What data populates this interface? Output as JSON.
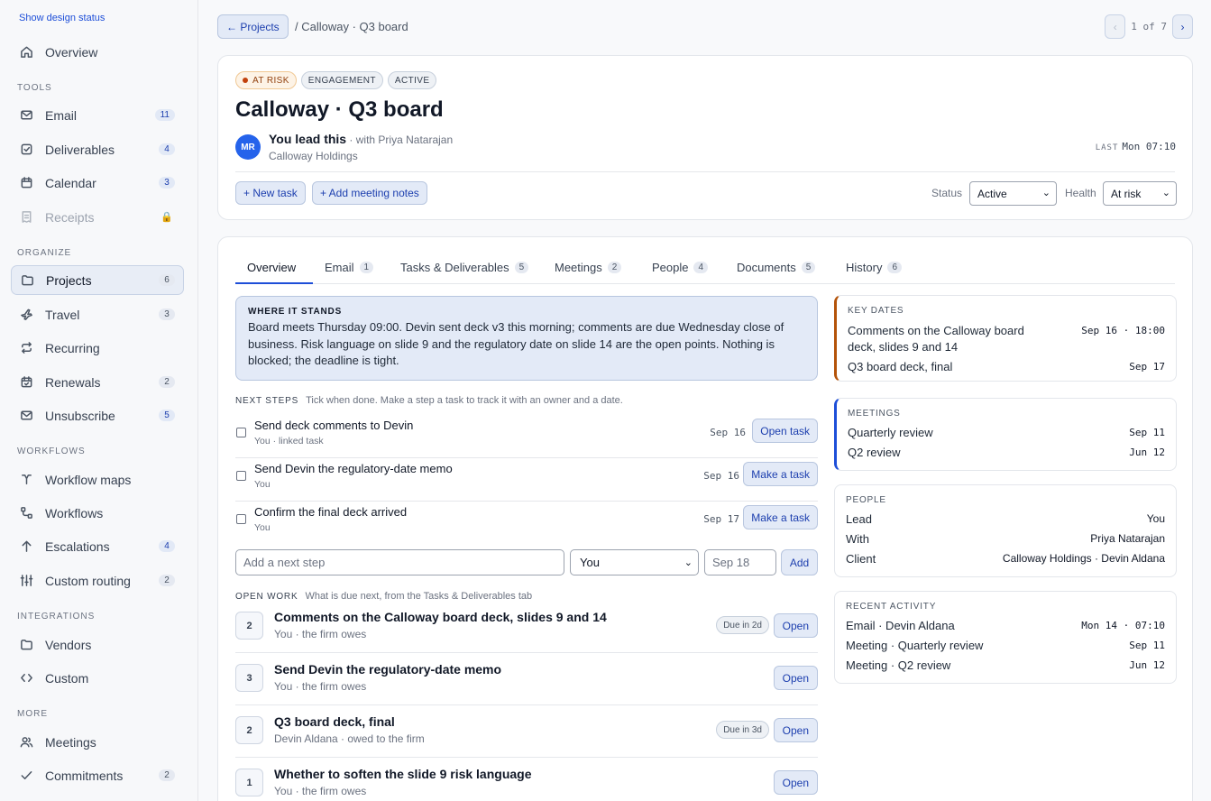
{
  "sidebar": {
    "design_status": "Show design status",
    "overview": "Overview",
    "sections": {
      "tools": "TOOLS",
      "organize": "ORGANIZE",
      "workflows": "WORKFLOWS",
      "integrations": "INTEGRATIONS",
      "more": "MORE"
    },
    "items": {
      "email": {
        "label": "Email",
        "count": "11"
      },
      "deliverables": {
        "label": "Deliverables",
        "count": "4"
      },
      "calendar": {
        "label": "Calendar",
        "count": "3"
      },
      "receipts": {
        "label": "Receipts"
      },
      "projects": {
        "label": "Projects",
        "count": "6"
      },
      "travel": {
        "label": "Travel",
        "count": "3"
      },
      "recurring": {
        "label": "Recurring"
      },
      "renewals": {
        "label": "Renewals",
        "count": "2"
      },
      "unsubscribe": {
        "label": "Unsubscribe",
        "count": "5"
      },
      "workflow_maps": {
        "label": "Workflow maps"
      },
      "workflows": {
        "label": "Workflows"
      },
      "escalations": {
        "label": "Escalations",
        "count": "4"
      },
      "custom_routing": {
        "label": "Custom routing",
        "count": "2"
      },
      "vendors": {
        "label": "Vendors"
      },
      "custom": {
        "label": "Custom"
      },
      "meetings": {
        "label": "Meetings"
      },
      "commitments": {
        "label": "Commitments",
        "count": "2"
      }
    }
  },
  "topbar": {
    "back_label": "← Projects",
    "breadcrumb": "/ Calloway · Q3 board",
    "pager_prev": "‹",
    "pager_text": "1 of 7",
    "pager_next": "›"
  },
  "header": {
    "badges": {
      "risk": "AT RISK",
      "type": "ENGAGEMENT",
      "state": "ACTIVE"
    },
    "title": "Calloway · Q3 board",
    "avatar": "MR",
    "lead": "You lead this",
    "with": " · with Priya Natarajan",
    "client": "Calloway Holdings",
    "last_label": "LAST",
    "last_value": "Mon 07:10",
    "new_task": "+ New task",
    "add_notes": "+ Add meeting notes",
    "status_label": "Status",
    "status_value": "Active",
    "health_label": "Health",
    "health_value": "At risk"
  },
  "tabs": [
    {
      "label": "Overview"
    },
    {
      "label": "Email",
      "count": "1"
    },
    {
      "label": "Tasks & Deliverables",
      "count": "5"
    },
    {
      "label": "Meetings",
      "count": "2"
    },
    {
      "label": "People",
      "count": "4"
    },
    {
      "label": "Documents",
      "count": "5"
    },
    {
      "label": "History",
      "count": "6"
    }
  ],
  "where_it_stands": {
    "label": "WHERE IT STANDS",
    "text": "Board meets Thursday 09:00. Devin sent deck v3 this morning; comments are due Wednesday close of business. Risk language on slide 9 and the regulatory date on slide 14 are the open points. Nothing is blocked; the deadline is tight."
  },
  "next_steps": {
    "label": "NEXT STEPS",
    "hint": "Tick when done. Make a step a task to track it with an owner and a date.",
    "items": [
      {
        "title": "Send deck comments to Devin",
        "sub": "You · linked task",
        "date": "Sep 16",
        "action": "Open task"
      },
      {
        "title": "Send Devin the regulatory-date memo",
        "sub": "You",
        "date": "Sep 16",
        "action": "Make a task"
      },
      {
        "title": "Confirm the final deck arrived",
        "sub": "You",
        "date": "Sep 17",
        "action": "Make a task"
      }
    ],
    "add_placeholder": "Add a next step",
    "owner_value": "You",
    "date_placeholder": "Sep 18",
    "add_label": "Add"
  },
  "open_work": {
    "label": "OPEN WORK",
    "hint": "What is due next, from the Tasks & Deliverables tab",
    "items": [
      {
        "num": "2",
        "title": "Comments on the Calloway board deck, slides 9 and 14",
        "sub": "You · the firm owes",
        "due": "Due in 2d",
        "action": "Open"
      },
      {
        "num": "3",
        "title": "Send Devin the regulatory-date memo",
        "sub": "You · the firm owes",
        "action": "Open"
      },
      {
        "num": "2",
        "title": "Q3 board deck, final",
        "sub": "Devin Aldana · owed to the firm",
        "due": "Due in 3d",
        "action": "Open"
      },
      {
        "num": "1",
        "title": "Whether to soften the slide 9 risk language",
        "sub": "You · the firm owes",
        "action": "Open"
      }
    ]
  },
  "key_dates": {
    "label": "KEY DATES",
    "rows": [
      {
        "label": "Comments on the Calloway board deck, slides 9 and 14",
        "value": "Sep 16 · 18:00"
      },
      {
        "label": "Q3 board deck, final",
        "value": "Sep 17"
      }
    ]
  },
  "meetings": {
    "label": "MEETINGS",
    "rows": [
      {
        "label": "Quarterly review",
        "value": "Sep 11"
      },
      {
        "label": "Q2 review",
        "value": "Jun 12"
      }
    ]
  },
  "people": {
    "label": "PEOPLE",
    "rows": [
      {
        "label": "Lead",
        "value": "You"
      },
      {
        "label": "With",
        "value": "Priya Natarajan"
      },
      {
        "label": "Client",
        "value": "Calloway Holdings · Devin Aldana"
      }
    ]
  },
  "recent_activity": {
    "label": "RECENT ACTIVITY",
    "rows": [
      {
        "label": "Email · Devin Aldana",
        "value": "Mon 14 · 07:10"
      },
      {
        "label": "Meeting · Quarterly review",
        "value": "Sep 11"
      },
      {
        "label": "Meeting · Q2 review",
        "value": "Jun 12"
      }
    ]
  }
}
